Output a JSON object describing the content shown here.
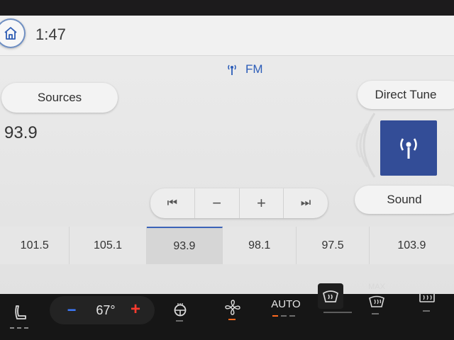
{
  "header": {
    "clock": "1:47"
  },
  "radio": {
    "band": "FM",
    "frequency": "93.9",
    "sources_label": "Sources",
    "direct_tune_label": "Direct Tune",
    "sound_label": "Sound"
  },
  "transport": [
    "⏮",
    "−",
    "+",
    "⏭"
  ],
  "presets": [
    "101.5",
    "105.1",
    "93.9",
    "98.1",
    "97.5",
    "103.9"
  ],
  "active_preset": "93.9",
  "climate": {
    "temperature": "67°",
    "minus_label": "−",
    "plus_label": "+",
    "auto_label": "AUTO",
    "max_label": "MAX"
  },
  "icons": [
    "home-icon",
    "antenna-icon",
    "seat-heat-icon",
    "heated-steering-icon",
    "fan-icon",
    "windshield-defrost-icon",
    "max-defrost-icon",
    "rear-defrost-icon"
  ],
  "colors": {
    "accent_blue": "#2b5cb8",
    "tile_blue": "#334d97",
    "minus_blue": "#3d7bff",
    "plus_red": "#ff3b2f",
    "indicator_orange": "#ff6a1f"
  }
}
